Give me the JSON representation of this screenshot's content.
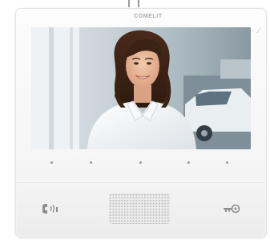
{
  "device": {
    "brand": "COMELIT"
  },
  "colors": {
    "housing": "#f7f7f7",
    "icon": "#8d8d8d",
    "screen_bezel": "#1b2430"
  },
  "screen": {
    "content": "video-feed-visitor"
  },
  "controls": {
    "talk_icon": "handset-icon",
    "door_icon": "key-icon"
  }
}
